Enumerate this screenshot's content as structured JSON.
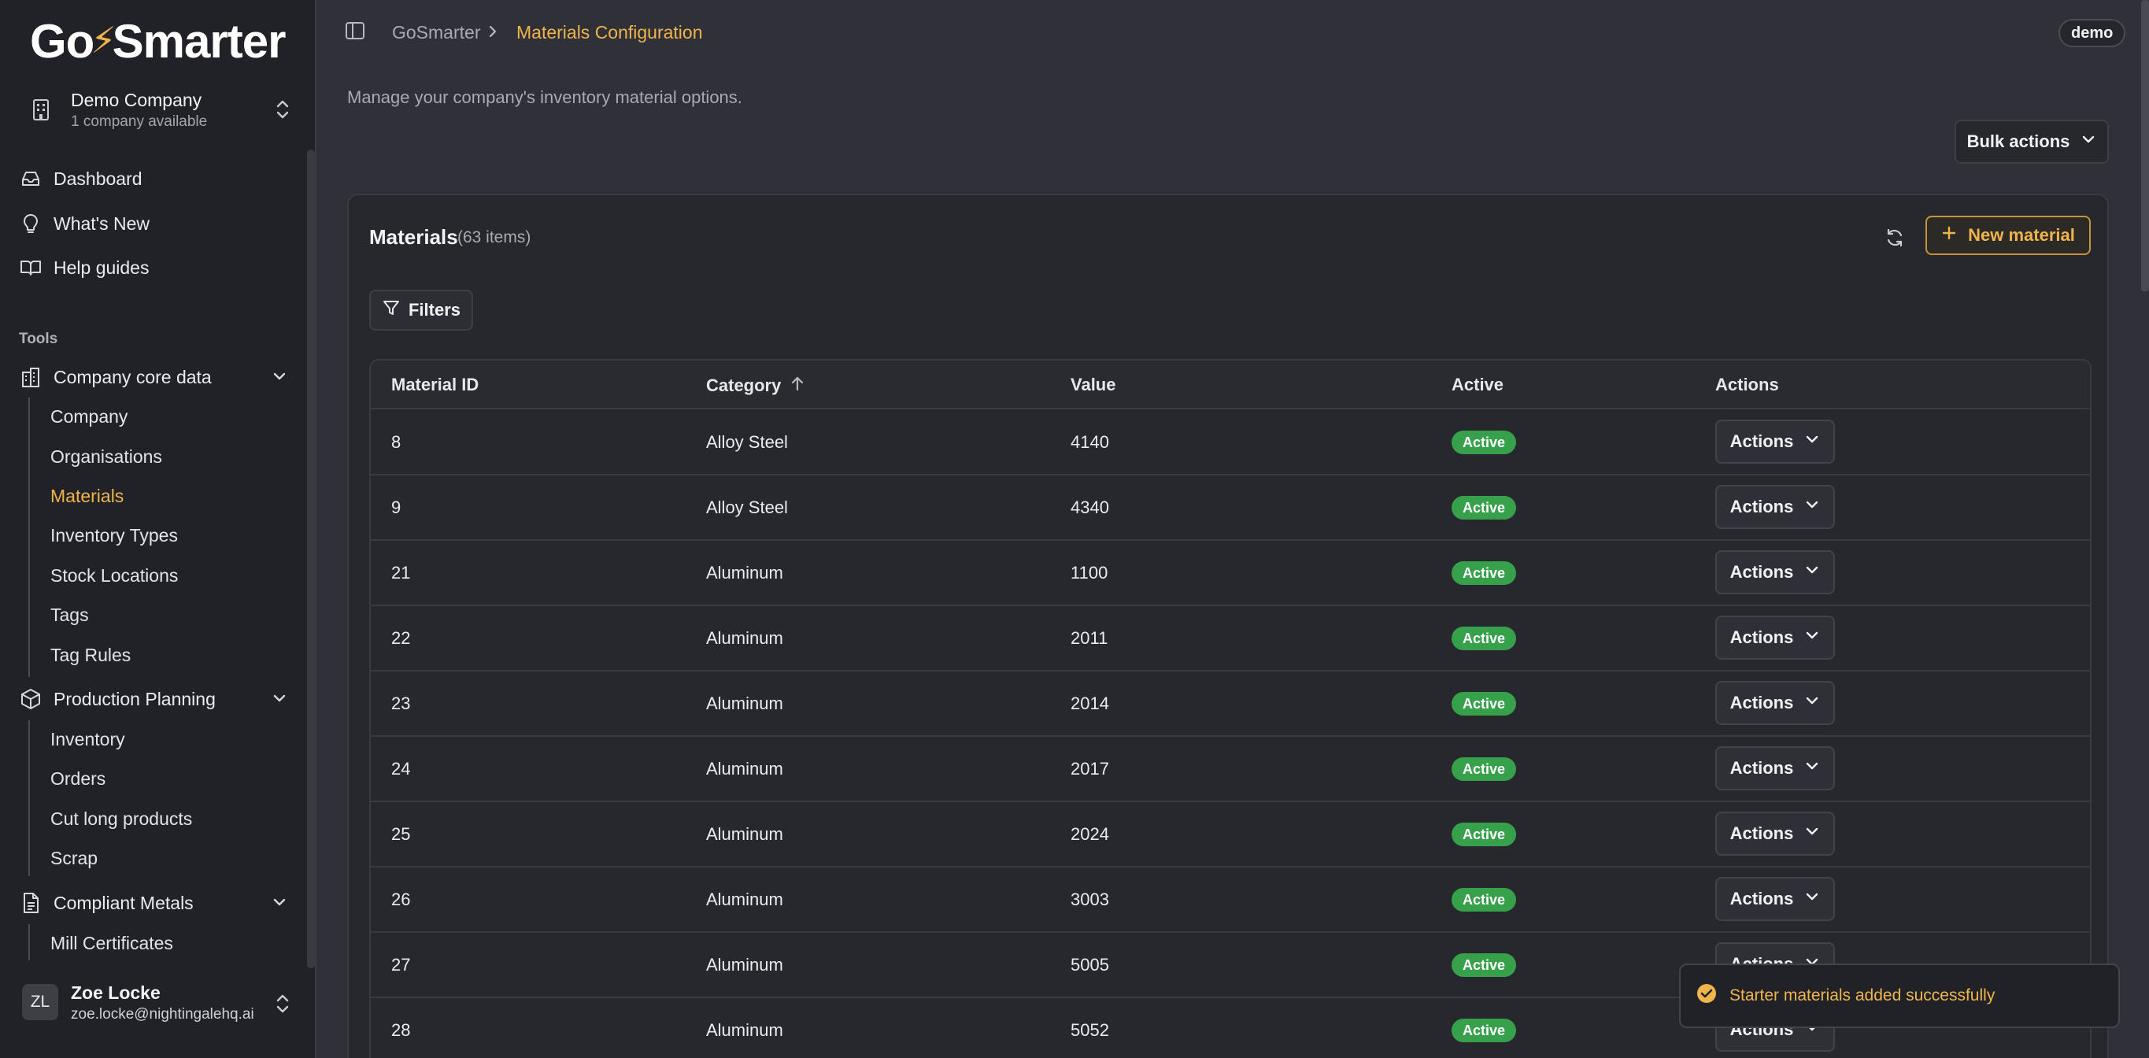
{
  "brand": {
    "logo_left": "Go",
    "logo_right": "Smarter",
    "accent": "#f0b44c"
  },
  "company": {
    "name": "Demo Company",
    "sub": "1 company available"
  },
  "nav": {
    "dashboard": "Dashboard",
    "whats_new": "What's New",
    "help": "Help guides",
    "tools_label": "Tools",
    "core_data": {
      "label": "Company core data",
      "items": [
        "Company",
        "Organisations",
        "Materials",
        "Inventory Types",
        "Stock Locations",
        "Tags",
        "Tag Rules"
      ]
    },
    "production": {
      "label": "Production Planning",
      "items": [
        "Inventory",
        "Orders",
        "Cut long products",
        "Scrap"
      ]
    },
    "compliant": {
      "label": "Compliant Metals",
      "items": [
        "Mill Certificates"
      ]
    }
  },
  "user": {
    "initials": "ZL",
    "name": "Zoe Locke",
    "email": "zoe.locke@nightingalehq.ai"
  },
  "breadcrumb": {
    "root": "GoSmarter",
    "current": "Materials Configuration"
  },
  "env_badge": "demo",
  "description": "Manage your company's inventory material options.",
  "bulk_actions": "Bulk actions",
  "panel": {
    "title": "Materials",
    "count": "(63 items)",
    "new_button": "New material",
    "filters": "Filters"
  },
  "table": {
    "headers": {
      "id": "Material ID",
      "category": "Category",
      "value": "Value",
      "active": "Active",
      "actions": "Actions"
    },
    "rows": [
      {
        "id": "8",
        "category": "Alloy Steel",
        "value": "4140",
        "status": "Active",
        "action": "Actions"
      },
      {
        "id": "9",
        "category": "Alloy Steel",
        "value": "4340",
        "status": "Active",
        "action": "Actions"
      },
      {
        "id": "21",
        "category": "Aluminum",
        "value": "1100",
        "status": "Active",
        "action": "Actions"
      },
      {
        "id": "22",
        "category": "Aluminum",
        "value": "2011",
        "status": "Active",
        "action": "Actions"
      },
      {
        "id": "23",
        "category": "Aluminum",
        "value": "2014",
        "status": "Active",
        "action": "Actions"
      },
      {
        "id": "24",
        "category": "Aluminum",
        "value": "2017",
        "status": "Active",
        "action": "Actions"
      },
      {
        "id": "25",
        "category": "Aluminum",
        "value": "2024",
        "status": "Active",
        "action": "Actions"
      },
      {
        "id": "26",
        "category": "Aluminum",
        "value": "3003",
        "status": "Active",
        "action": "Actions"
      },
      {
        "id": "27",
        "category": "Aluminum",
        "value": "5005",
        "status": "Active",
        "action": "Actions"
      },
      {
        "id": "28",
        "category": "Aluminum",
        "value": "5052",
        "status": "Active",
        "action": "Actions"
      }
    ]
  },
  "toast": {
    "message": "Starter materials added successfully"
  }
}
